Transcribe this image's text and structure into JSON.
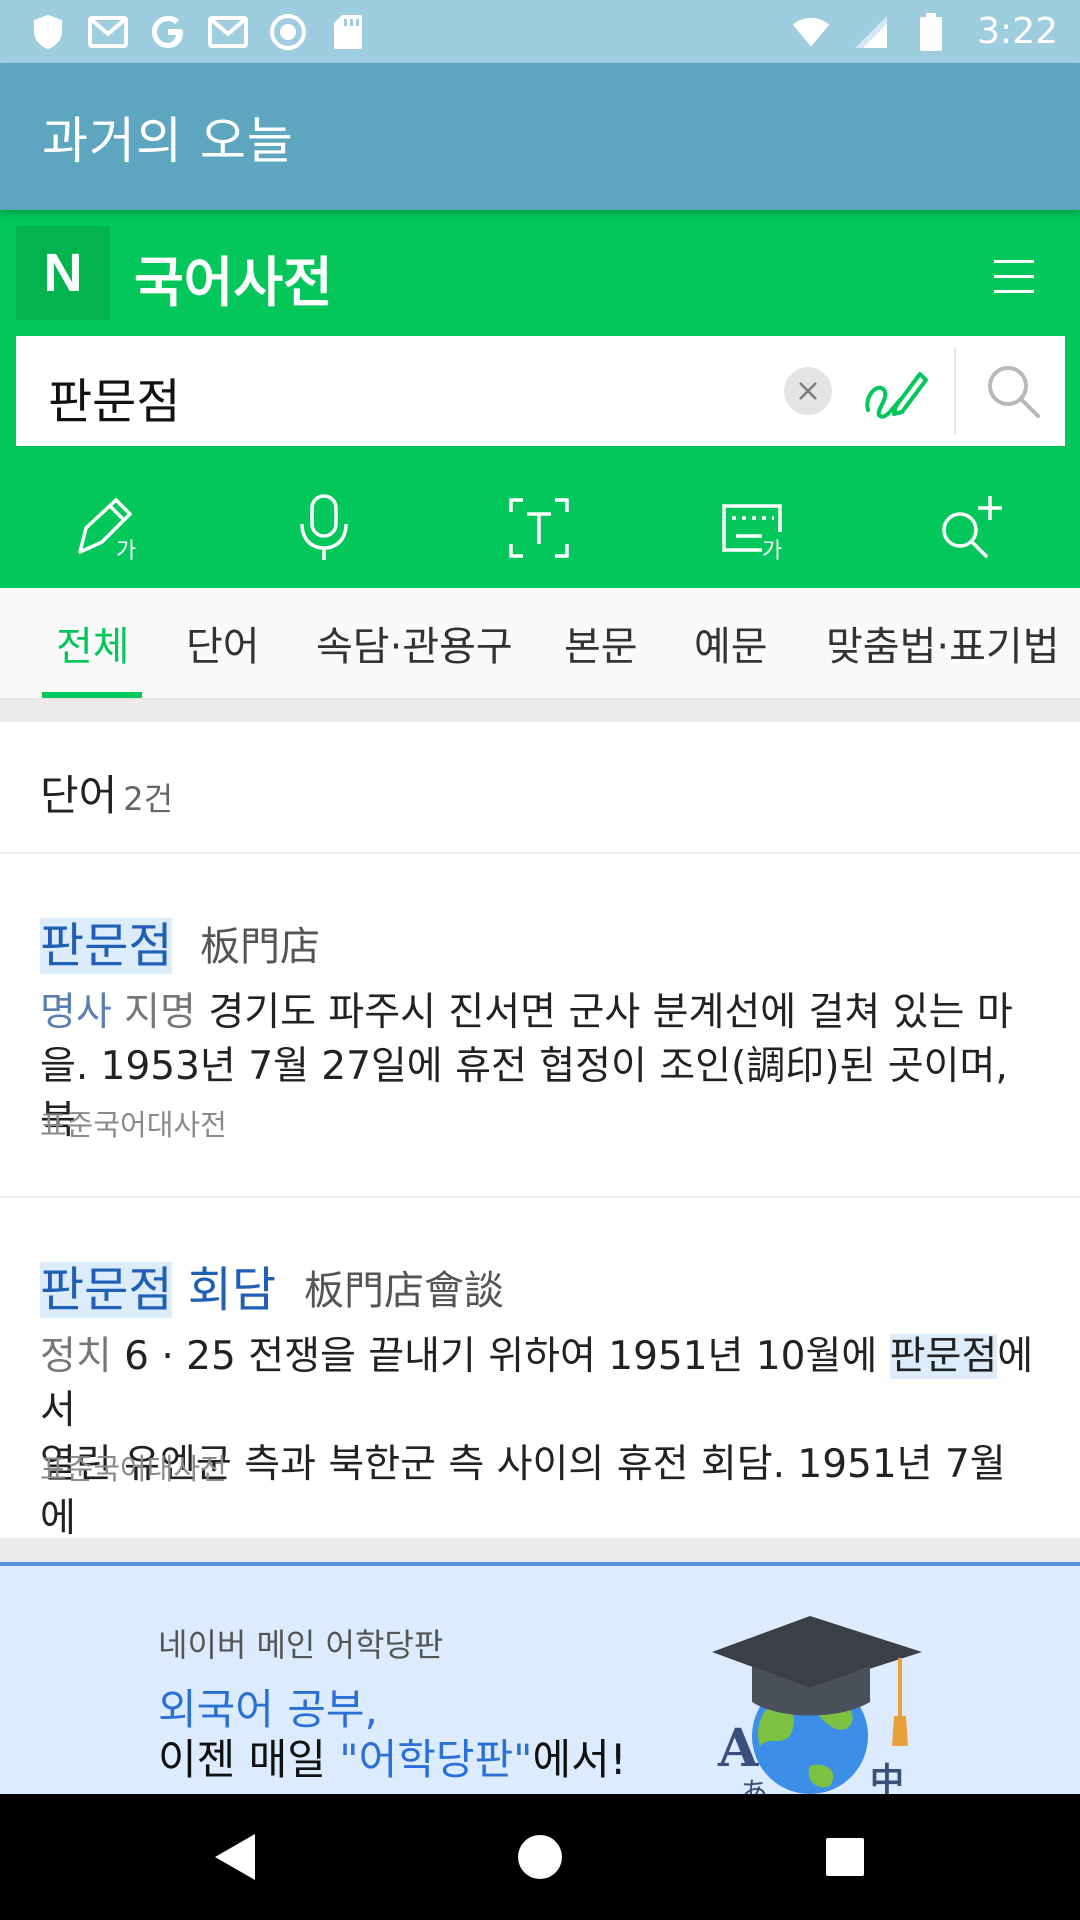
{
  "status_bar": {
    "time": "3:22",
    "left_icons": [
      "shield-icon",
      "gmail-icon",
      "google-icon",
      "gmail-icon",
      "record-icon",
      "sd-card-icon"
    ],
    "right_icons": [
      "wifi-icon",
      "signal-icon",
      "battery-icon"
    ]
  },
  "app_bar": {
    "title": "과거의 오늘"
  },
  "dictionary": {
    "logo": "N",
    "title": "국어사전",
    "search_value": "판문점",
    "brand_color": "#03c75a"
  },
  "tools": [
    "handwriting-icon",
    "microphone-icon",
    "text-recognition-icon",
    "keyboard-icon",
    "search-plus-icon"
  ],
  "tabs": [
    {
      "label": "전체",
      "active": true
    },
    {
      "label": "단어"
    },
    {
      "label": "속담·관용구"
    },
    {
      "label": "본문"
    },
    {
      "label": "예문"
    },
    {
      "label": "맞춤법·표기법"
    }
  ],
  "section": {
    "title": "단어",
    "count": "2건"
  },
  "entries": [
    {
      "title_hl": "판문점",
      "title_rest": "",
      "hanja": "板門店",
      "pos1": "명사",
      "pos2": "지명",
      "line1": "경기도 파주시 진서면 군사 분계선에 걸쳐 있는 마",
      "line2": "을. 1953년 7월 27일에 휴전 협정이 조인(調印)된 곳이며, 북",
      "source": "표준국어대사전"
    },
    {
      "title_hl": "판문점",
      "title_rest": "회담",
      "hanja": "板門店會談",
      "pos1": "정치",
      "line1_a": "6 · 25 전쟁을 끝내기 위하여 1951년 10월에",
      "line1_hl": "판문점",
      "line1_b": "에서",
      "line2": "열린 유엔군 측과 북한군 측 사이의 휴전 회담. 1951년 7월에",
      "source": "표준국어대사전"
    }
  ],
  "banner": {
    "subtitle": "네이버 메인 어학당판",
    "line1": "외국어 공부,",
    "line2_a": "이젠 매일 ",
    "line2_q": "\"어학당판\"",
    "line2_b": "에서!",
    "art_letters": [
      "A",
      "あ",
      "中"
    ]
  },
  "nav": [
    "back-icon",
    "home-icon",
    "recents-icon"
  ]
}
